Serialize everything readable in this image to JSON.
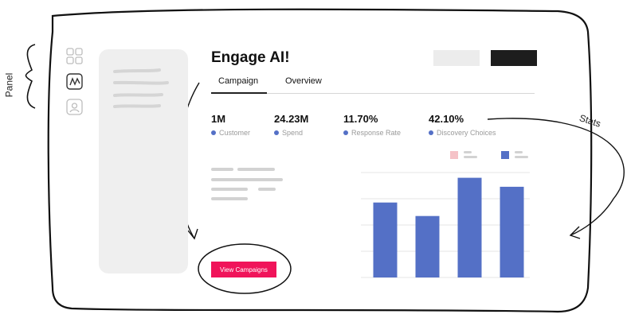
{
  "header": {
    "title": "Engage AI!"
  },
  "tabs": [
    {
      "label": "Campaign",
      "active": true
    },
    {
      "label": "Overview",
      "active": false
    }
  ],
  "stats": [
    {
      "value": "1M",
      "label": "Customer"
    },
    {
      "value": "24.23M",
      "label": "Spend"
    },
    {
      "value": "11.70%",
      "label": "Response Rate"
    },
    {
      "value": "42.10%",
      "label": "Discovery Choices"
    }
  ],
  "cta": {
    "label": "View Campaigns"
  },
  "annotations": {
    "panel": "Panel",
    "stats": "Stats"
  },
  "colors": {
    "accent": "#f0145a",
    "bar": "#5470c6",
    "legend_pink": "#f5c2c7",
    "dark": "#1d1d1d"
  },
  "rail_icons": [
    "grid-icon",
    "activity-icon",
    "user-icon"
  ],
  "chart_data": {
    "type": "bar",
    "categories": [
      "",
      "",
      "",
      ""
    ],
    "values": [
      100,
      82,
      133,
      121
    ],
    "ylim": [
      0,
      140
    ],
    "grid": true
  }
}
